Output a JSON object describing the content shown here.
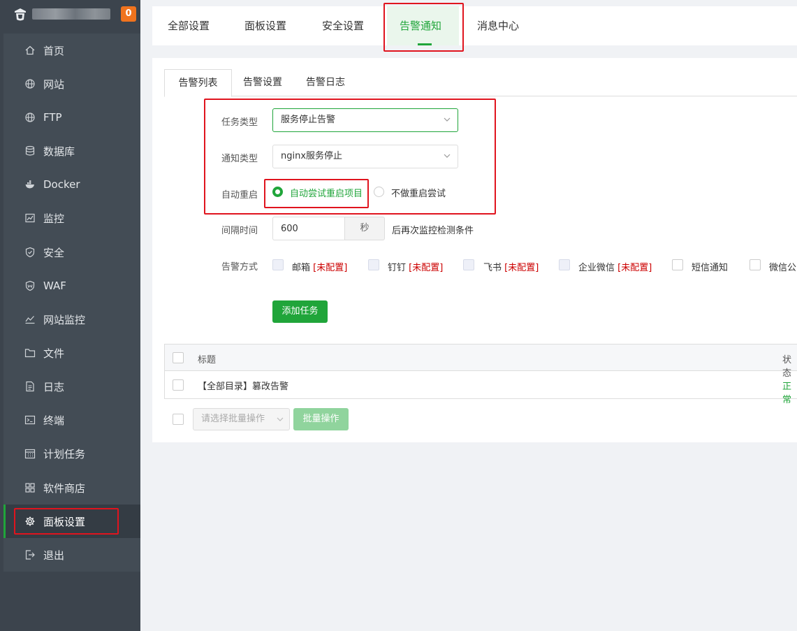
{
  "sidebar": {
    "badge": "0",
    "items": [
      {
        "label": "首页",
        "icon": "home-icon"
      },
      {
        "label": "网站",
        "icon": "globe-icon"
      },
      {
        "label": "FTP",
        "icon": "globe-icon"
      },
      {
        "label": "数据库",
        "icon": "database-icon"
      },
      {
        "label": "Docker",
        "icon": "docker-icon"
      },
      {
        "label": "监控",
        "icon": "monitor-icon"
      },
      {
        "label": "安全",
        "icon": "shield-icon"
      },
      {
        "label": "WAF",
        "icon": "waf-shield-icon"
      },
      {
        "label": "网站监控",
        "icon": "chart-line-icon"
      },
      {
        "label": "文件",
        "icon": "folder-icon"
      },
      {
        "label": "日志",
        "icon": "log-icon"
      },
      {
        "label": "终端",
        "icon": "terminal-icon"
      },
      {
        "label": "计划任务",
        "icon": "calendar-icon"
      },
      {
        "label": "软件商店",
        "icon": "apps-icon"
      },
      {
        "label": "面板设置",
        "icon": "gear-icon"
      },
      {
        "label": "退出",
        "icon": "logout-icon"
      }
    ],
    "active_index": 14
  },
  "top_tabs": [
    "全部设置",
    "面板设置",
    "安全设置",
    "告警通知",
    "消息中心"
  ],
  "sub_tabs": [
    "告警列表",
    "告警设置",
    "告警日志"
  ],
  "form": {
    "task_type_label": "任务类型",
    "task_type_value": "服务停止告警",
    "notify_type_label": "通知类型",
    "notify_type_value": "nginx服务停止",
    "auto_restart_label": "自动重启",
    "auto_restart_on": "自动尝试重启项目",
    "auto_restart_off": "不做重启尝试",
    "interval_label": "间隔时间",
    "interval_value": "600",
    "interval_unit": "秒",
    "interval_suffix": "后再次监控检测条件",
    "method_label": "告警方式",
    "not_configured": "[未配置]",
    "methods": [
      "邮箱",
      "钉钉",
      "飞书",
      "企业微信",
      "短信通知",
      "微信公"
    ],
    "add_button": "添加任务"
  },
  "table": {
    "col_title": "标题",
    "col_status": "状态",
    "rows": [
      {
        "title": "【全部目录】篡改告警",
        "status": "正常"
      }
    ]
  },
  "bulk": {
    "placeholder": "请选择批量操作",
    "button": "批量操作"
  },
  "colors": {
    "accent": "#20a53a",
    "sidebar_bg": "#434c55",
    "annotation": "#e0141e",
    "badge": "#f0731e"
  }
}
